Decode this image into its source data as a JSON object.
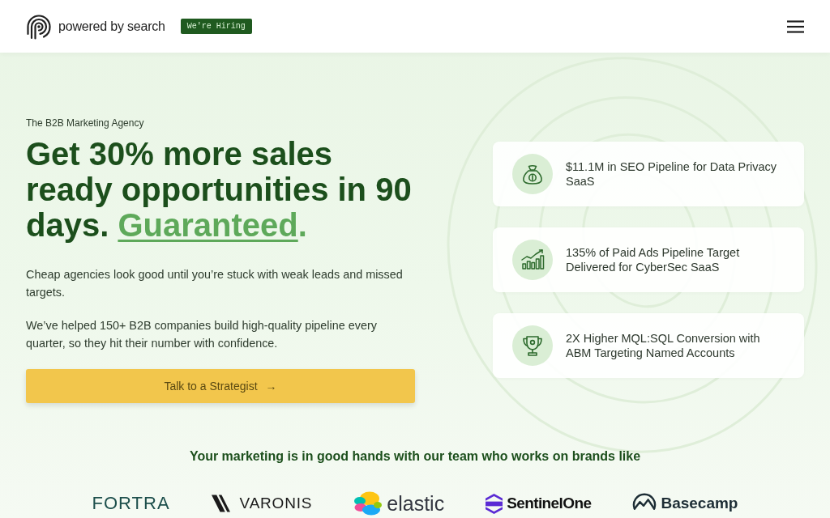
{
  "header": {
    "logo_text": "powered by search",
    "badge": "We're Hiring"
  },
  "hero": {
    "tagline": "The B2B Marketing Agency",
    "headline": {
      "lead": "Get 30% more sales ready opportunities in 90 days.",
      "highlight": "Guaranteed",
      "tail": "."
    },
    "paragraphs": [
      "Cheap agencies look good until you’re stuck with weak leads and missed targets.",
      "We’ve helped 150+ B2B companies build high-quality pipeline every quarter, so they hit their number with confidence."
    ],
    "cta": {
      "label": "Talk to a Strategist",
      "arrow": "→"
    }
  },
  "results": [
    {
      "kind": "moneybag",
      "text": "$11.1M in SEO Pipeline for Data Privacy SaaS"
    },
    {
      "kind": "chart",
      "text": "135% of Paid Ads Pipeline Target Delivered for CyberSec SaaS"
    },
    {
      "kind": "trophy",
      "text": "2X Higher MQL:SQL Conversion with ABM Targeting Named Accounts"
    }
  ],
  "brands": {
    "heading": "Your marketing is in good hands with our team who works on brands like",
    "logos": [
      {
        "kind": "plain",
        "name": "FORTRA",
        "color": "#1d4f4c"
      },
      {
        "kind": "slashes",
        "name": "VARONIS",
        "color": "#1a1a1a"
      },
      {
        "kind": "flower",
        "name": "elastic",
        "color": "#343741"
      },
      {
        "kind": "stack",
        "name": "SentinelOne",
        "color": "#111111"
      },
      {
        "kind": "arc",
        "name": "Basecamp",
        "color": "#1d2d35"
      }
    ]
  }
}
